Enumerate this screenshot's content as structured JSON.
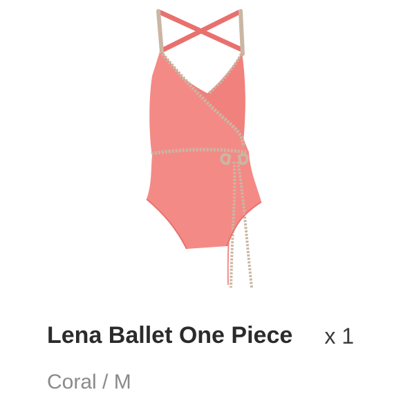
{
  "product": {
    "image_alt": "swimsuit-image",
    "title": "Lena Ballet One Piece",
    "quantity": "x 1",
    "variant": "Coral / M"
  },
  "colors": {
    "swimsuit": "#f48a86",
    "swimsuit_shadow": "#e8716e",
    "trim": "#c9b7a4",
    "title_text": "#2b2b2b",
    "variant_text": "#8a8a8a"
  }
}
